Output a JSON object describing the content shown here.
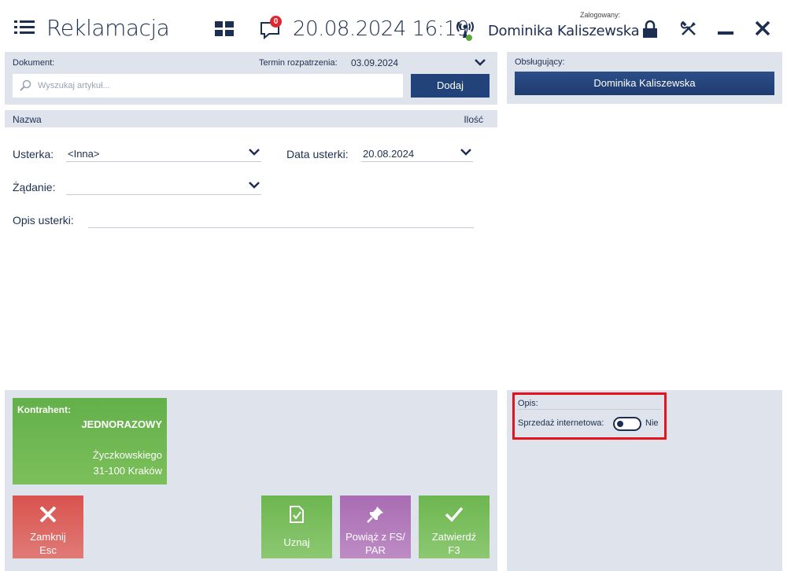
{
  "header": {
    "title": "Reklamacja",
    "datetime": "20.08.2024 16:19",
    "messages_count": "0",
    "logged_label": "Zalogowany:",
    "user_name": "Dominika Kaliszewska"
  },
  "document": {
    "label": "Dokument:",
    "term_label": "Termin rozpatrzenia:",
    "term_value": "03.09.2024",
    "search_placeholder": "Wyszukaj artykuł...",
    "add_label": "Dodaj"
  },
  "handler": {
    "label": "Obsługujący:",
    "name": "Dominika Kaliszewska"
  },
  "columns": {
    "name": "Nazwa",
    "qty": "Ilość"
  },
  "form": {
    "defect_label": "Usterka:",
    "defect_value": "<Inna>",
    "defect_date_label": "Data usterki:",
    "defect_date_value": "20.08.2024",
    "request_label": "Żądanie:",
    "request_value": "",
    "description_label": "Opis usterki:",
    "description_value": ""
  },
  "contractor": {
    "label": "Kontrahent:",
    "name": "JEDNORAZOWY",
    "street": "Życzkowskiego",
    "city": "31-100 Kraków"
  },
  "actions": {
    "close_line1": "Zamknij",
    "close_line2": "Esc",
    "accept_label": "Uznaj",
    "link_line1": "Powiąż z FS/",
    "link_line2": "PAR",
    "confirm_line1": "Zatwierdź",
    "confirm_line2": "F3"
  },
  "details": {
    "description_label": "Opis:",
    "online_sale_label": "Sprzedaż internetowa:",
    "online_sale_value": "Nie"
  },
  "colors": {
    "primary": "#1d2f50",
    "button": "#22427a",
    "panel": "#dfe4ec",
    "green": "#6db650",
    "red": "#d9534f",
    "purple": "#b076b8",
    "highlight": "#e8121e"
  }
}
